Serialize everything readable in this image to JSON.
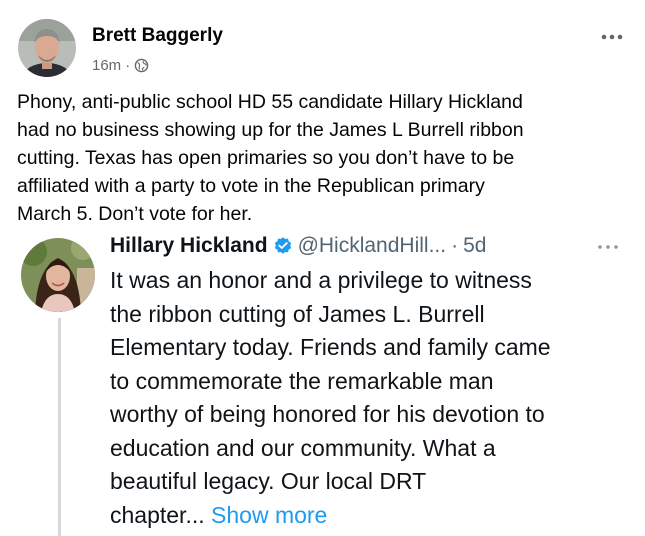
{
  "post": {
    "author": "Brett Baggerly",
    "time": "16m",
    "meta_sep": "·",
    "audience_icon": "globe-icon",
    "more_icon": "more-horizontal-icon",
    "text_lines": [
      "Phony, anti-public school HD 55 candidate Hillary Hickland",
      "had no business showing up for the James L Burrell ribbon",
      "cutting. Texas has open primaries so you don’t have to be",
      "affiliated with a party to vote in the Republican primary",
      "March 5. Don’t vote for her."
    ]
  },
  "tweet": {
    "name": "Hillary Hickland",
    "verified_icon": "verified-badge-icon",
    "handle": "@HicklandHill...",
    "sep": "·",
    "time": "5d",
    "more_icon": "more-horizontal-icon",
    "text_lines": [
      "It was an honor and a privilege to witness",
      "the ribbon cutting of James L. Burrell",
      "Elementary today. Friends and family came",
      "to commemorate the remarkable man",
      "worthy of being honored for his devotion to",
      "education and our community. What a",
      "beautiful legacy. Our local DRT"
    ],
    "last_line_text": "chapter... ",
    "show_more": "Show more"
  },
  "colors": {
    "text": "#050505",
    "meta": "#65676b",
    "tweet_text": "#0f1419",
    "tweet_meta": "#536471",
    "link": "#1d9bf0",
    "verified": "#1d9bf0",
    "rail": "#d6d9dc"
  }
}
